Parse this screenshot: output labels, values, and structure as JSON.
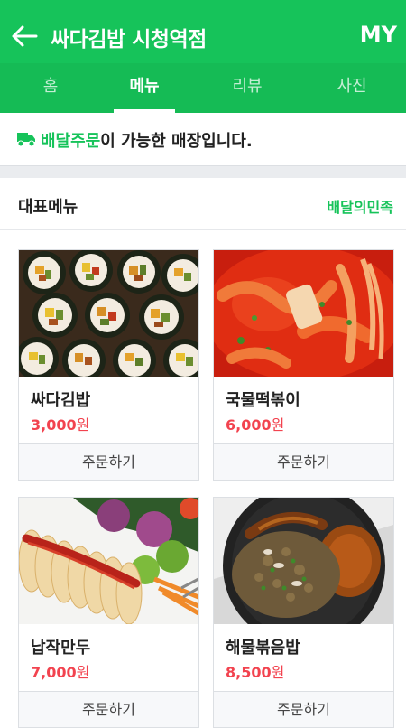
{
  "header": {
    "title": "싸다김밥 시청역점",
    "my_label": "MY"
  },
  "tabs": [
    {
      "label": "홈",
      "active": false
    },
    {
      "label": "메뉴",
      "active": true
    },
    {
      "label": "리뷰",
      "active": false
    },
    {
      "label": "사진",
      "active": false
    }
  ],
  "notice": {
    "highlight": "배달주문",
    "rest": "이 가능한 매장입니다."
  },
  "section": {
    "title": "대표메뉴",
    "link": "배달의민족"
  },
  "menu_items": [
    {
      "name": "싸다김밥",
      "price": "3,000",
      "currency": "원",
      "button": "주문하기",
      "image": "kimbap-photo"
    },
    {
      "name": "국물떡볶이",
      "price": "6,000",
      "currency": "원",
      "button": "주문하기",
      "image": "tteokbokki-photo"
    },
    {
      "name": "납작만두",
      "price": "7,000",
      "currency": "원",
      "button": "주문하기",
      "image": "flat-dumpling-photo"
    },
    {
      "name": "해물볶음밥",
      "price": "8,500",
      "currency": "원",
      "button": "주문하기",
      "image": "seafood-fried-rice-photo"
    }
  ],
  "colors": {
    "brand_green": "#16c35a",
    "price_red": "#f2434f"
  }
}
